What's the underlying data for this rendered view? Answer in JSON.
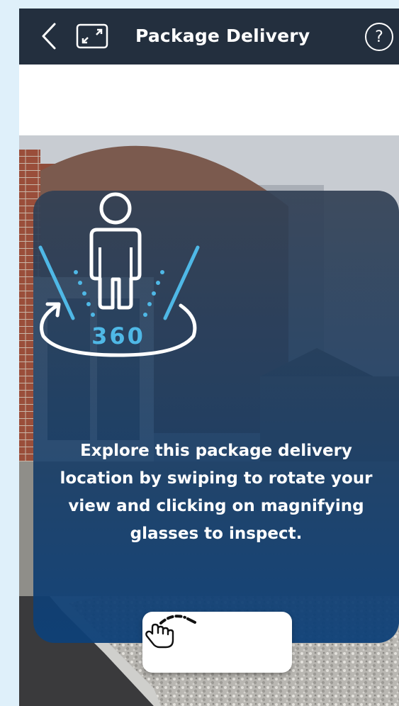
{
  "header": {
    "back_icon": "chevron-left-icon",
    "expand_icon": "expand-icon",
    "title": "Package Delivery",
    "help_icon": "help-circle-icon",
    "help_glyph": "?"
  },
  "intro": {
    "icon": "person-360-icon",
    "icon_label": "360",
    "text": "Explore this package delivery location by swiping to rotate your view and clicking on magnifying glasses to inspect.",
    "dismiss_icon": "swipe-hand-icon"
  },
  "colors": {
    "header_bg": "#232f3e",
    "accent_blue": "#4fb8e6",
    "card_bottom": "#0d4078",
    "page_bg": "#dff0fa"
  }
}
